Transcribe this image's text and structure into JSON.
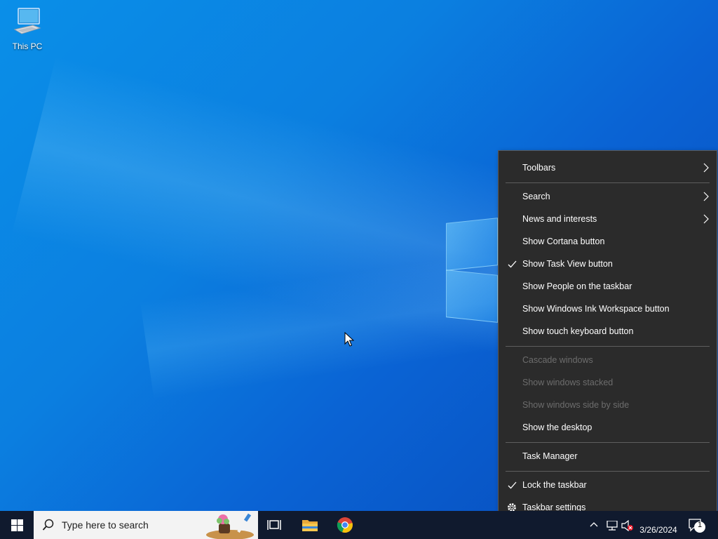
{
  "desktop": {
    "icons": [
      {
        "label": "This PC",
        "icon": "computer-icon"
      }
    ]
  },
  "context_menu": {
    "items": [
      {
        "label": "Toolbars",
        "submenu": true,
        "checked": false,
        "disabled": false
      },
      {
        "label": "Search",
        "submenu": true,
        "checked": false,
        "disabled": false
      },
      {
        "label": "News and interests",
        "submenu": true,
        "checked": false,
        "disabled": false
      },
      {
        "label": "Show Cortana button",
        "submenu": false,
        "checked": false,
        "disabled": false
      },
      {
        "label": "Show Task View button",
        "submenu": false,
        "checked": true,
        "disabled": false
      },
      {
        "label": "Show People on the taskbar",
        "submenu": false,
        "checked": false,
        "disabled": false
      },
      {
        "label": "Show Windows Ink Workspace button",
        "submenu": false,
        "checked": false,
        "disabled": false
      },
      {
        "label": "Show touch keyboard button",
        "submenu": false,
        "checked": false,
        "disabled": false
      },
      {
        "label": "Cascade windows",
        "submenu": false,
        "checked": false,
        "disabled": true
      },
      {
        "label": "Show windows stacked",
        "submenu": false,
        "checked": false,
        "disabled": true
      },
      {
        "label": "Show windows side by side",
        "submenu": false,
        "checked": false,
        "disabled": true
      },
      {
        "label": "Show the desktop",
        "submenu": false,
        "checked": false,
        "disabled": false
      },
      {
        "label": "Task Manager",
        "submenu": false,
        "checked": false,
        "disabled": false
      },
      {
        "label": "Lock the taskbar",
        "submenu": false,
        "checked": true,
        "disabled": false
      },
      {
        "label": "Taskbar settings",
        "submenu": false,
        "icon": "gear-icon",
        "checked": false,
        "disabled": false
      }
    ]
  },
  "taskbar": {
    "start_icon": "windows-logo-icon",
    "search_placeholder": "Type here to search",
    "pinned": [
      {
        "name": "Task View",
        "icon": "task-view-icon"
      },
      {
        "name": "File Explorer",
        "icon": "folder-icon"
      },
      {
        "name": "Google Chrome",
        "icon": "chrome-icon"
      }
    ],
    "tray": {
      "date": "3/26/2024",
      "notification_count": "1"
    }
  },
  "colors": {
    "menu_bg": "#2b2b2b",
    "menu_text": "#ffffff",
    "menu_disabled_text": "#6d6d6d",
    "taskbar_bg": "#101a2e",
    "desktop_blue": "#0b7fe0"
  }
}
